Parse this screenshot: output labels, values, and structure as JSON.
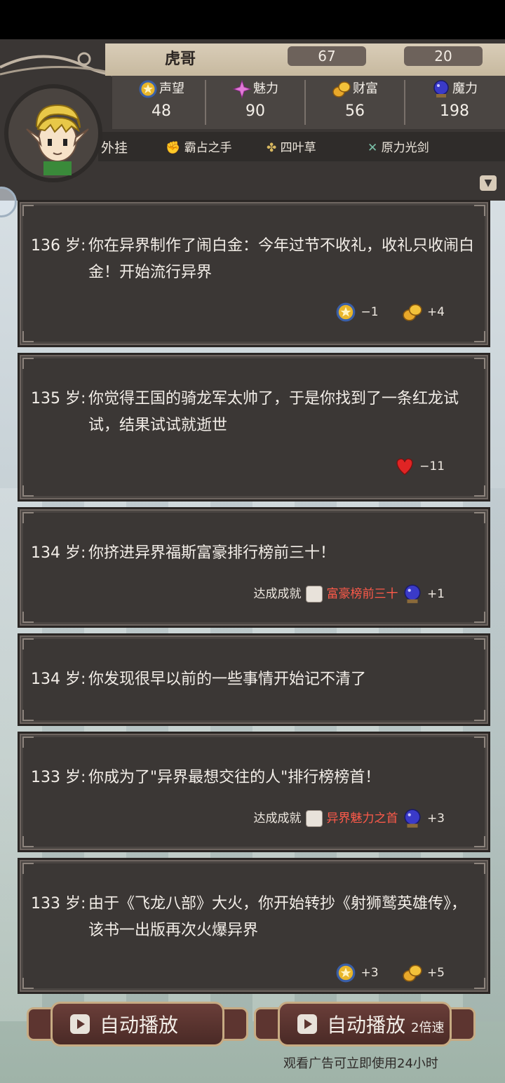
{
  "player": {
    "name": "虎哥",
    "attack": "67",
    "health": "20"
  },
  "stats": [
    {
      "label": "声望",
      "value": "48",
      "icon": "medal-icon"
    },
    {
      "label": "魅力",
      "value": "90",
      "icon": "sparkle-icon"
    },
    {
      "label": "财富",
      "value": "56",
      "icon": "coins-icon"
    },
    {
      "label": "魔力",
      "value": "198",
      "icon": "crystal-ball-icon"
    }
  ],
  "cheats": {
    "title": "外挂",
    "items": [
      "霸占之手",
      "四叶草",
      "原力光剑"
    ]
  },
  "events": [
    {
      "age": "136 岁:",
      "text": "你在异界制作了闹白金：今年过节不收礼，收礼只收闹白金！开始流行异界",
      "effects": [
        {
          "icon": "medal-icon",
          "value": "−1"
        },
        {
          "icon": "coins-icon",
          "value": "+4"
        }
      ]
    },
    {
      "age": "135 岁:",
      "text": "你觉得王国的骑龙军太帅了，于是你找到了一条红龙试试，结果试试就逝世",
      "effects": [
        {
          "icon": "heart-icon",
          "value": "−11"
        }
      ]
    },
    {
      "age": "134 岁:",
      "text": "你挤进异界福斯富豪排行榜前三十！",
      "achievement_label": "达成成就",
      "achievement": "富豪榜前三十",
      "effects": [
        {
          "icon": "crystal-ball-icon",
          "value": "+1"
        }
      ]
    },
    {
      "age": "134 岁:",
      "text": "你发现很早以前的一些事情开始记不清了"
    },
    {
      "age": "133 岁:",
      "text": "你成为了\"异界最想交往的人\"排行榜榜首！",
      "achievement_label": "达成成就",
      "achievement": "异界魅力之首",
      "effects": [
        {
          "icon": "crystal-ball-icon",
          "value": "+3"
        }
      ]
    },
    {
      "age": "133 岁:",
      "text": "由于《飞龙八部》大火，你开始转抄《射狮鹫英雄传》，该书一出版再次火爆异界",
      "effects": [
        {
          "icon": "medal-icon",
          "value": "+3"
        },
        {
          "icon": "coins-icon",
          "value": "+5"
        }
      ]
    }
  ],
  "buttons": {
    "auto_play": "自动播放",
    "auto_play_fast": "自动播放",
    "speed": "2倍速",
    "ad_note": "观看广告可立即使用24小时"
  },
  "colors": {
    "panel": "#3b3735",
    "achievement": "#ff5a4a",
    "button": "#5d3530",
    "button_border": "#c7ab83"
  }
}
